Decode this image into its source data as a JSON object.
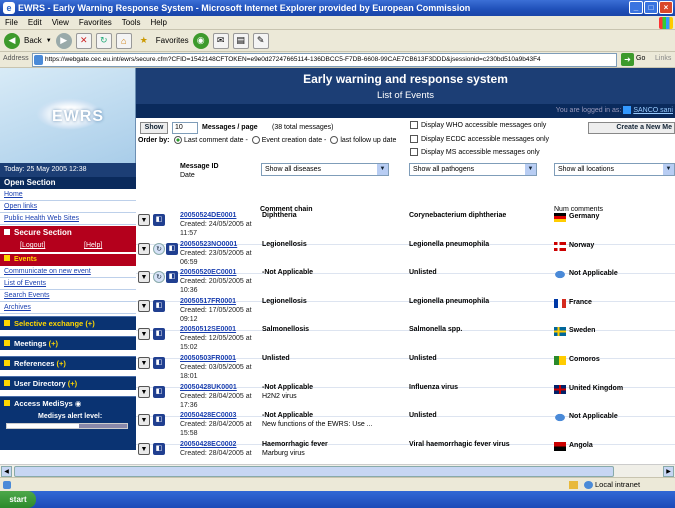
{
  "window": {
    "title": "EWRS - Early Warning Response System - Microsoft Internet Explorer provided by European Commission"
  },
  "menubar": {
    "items": [
      "File",
      "Edit",
      "View",
      "Favorites",
      "Tools",
      "Help"
    ]
  },
  "toolbar": {
    "back": "Back",
    "favorites": "Favorites"
  },
  "address": {
    "label": "Address",
    "url": "https://webgate.cec.eu.int/ewrs/secure.cfm?CFID=1542148CFTOKEN=e9e0d27247665114-136DBCC5-F7DB-6608-99CAE7CB613F3DDD&jsessionid=c230bd510a9b43F4",
    "go": "Go",
    "links": "Links"
  },
  "sidebar": {
    "logo": "EWRS",
    "date": "Today: 25 May 2005 12:38",
    "open_section": "Open Section",
    "open_links": [
      "Home",
      "Open links",
      "Public Health Web Sites"
    ],
    "secure_section": "Secure Section",
    "logout": "[Logout]",
    "help": "[Help]",
    "events": "Events",
    "event_links": [
      "Communicate on new event",
      "List of Events",
      "Search Events",
      "Archives"
    ],
    "sections": [
      {
        "label": "Selective exchange",
        "badge": "(+)"
      },
      {
        "label": "Meetings",
        "badge": "(+)"
      },
      {
        "label": "References",
        "badge": "(+)"
      },
      {
        "label": "User Directory",
        "badge": "(+)"
      },
      {
        "label": "Access MediSys",
        "badge": ""
      }
    ],
    "medisys": "Medisys alert level:"
  },
  "main": {
    "title": "Early warning and response system",
    "subtitle": "List of Events",
    "logged_in": "You are logged in as:",
    "logged_user": "SANCO sani",
    "show_button": "Show",
    "messages_per_page": "10",
    "messages_label": "Messages / page",
    "total": "(38 total messages)",
    "order_by": "Order by:",
    "order_options": [
      "Last comment date -",
      "Event creation date -",
      "last follow up date"
    ],
    "display_checks": [
      "Display WHO accessible messages only",
      "Display ECDC accessible messages only",
      "Display MS accessible messages only"
    ],
    "create_button": "Create a New Me",
    "col_message_id": "Message ID",
    "col_date": "Date",
    "col_comment": "Comment chain",
    "col_num": "Num comments",
    "filter_disease": "Show all diseases",
    "filter_pathogen": "Show all pathogens",
    "filter_location": "Show all locations",
    "rows": [
      {
        "id": "20050524DE0001",
        "created": "Created: 24/05/2005 at",
        "time": "11:57",
        "disease": "Diphtheria",
        "sub": "",
        "pathogen": "Corynebacterium diphtheriae",
        "country": "Germany",
        "flag": "de",
        "hist": false
      },
      {
        "id": "20050523NO0001",
        "created": "Created: 23/05/2005 at",
        "time": "06:59",
        "disease": "Legionellosis",
        "sub": "",
        "pathogen": "Legionella pneumophila",
        "country": "Norway",
        "flag": "no",
        "hist": true
      },
      {
        "id": "20050520EC0001",
        "created": "Created: 20/05/2005 at",
        "time": "10:36",
        "disease": "-Not Applicable",
        "sub": "",
        "pathogen": "Unlisted",
        "country": "Not Applicable",
        "flag": "na",
        "hist": true
      },
      {
        "id": "20050517FR0001",
        "created": "Created: 17/05/2005 at",
        "time": "09:12",
        "disease": "Legionellosis",
        "sub": "",
        "pathogen": "Legionella pneumophila",
        "country": "France",
        "flag": "fr",
        "hist": false
      },
      {
        "id": "20050512SE0001",
        "created": "Created: 12/05/2005 at",
        "time": "15:02",
        "disease": "Salmonellosis",
        "sub": "",
        "pathogen": "Salmonella spp.",
        "country": "Sweden",
        "flag": "se",
        "hist": false
      },
      {
        "id": "20050503FR0001",
        "created": "Created: 03/05/2005 at",
        "time": "18:01",
        "disease": "Unlisted",
        "sub": "",
        "pathogen": "Unlisted",
        "country": "Comoros",
        "flag": "km",
        "hist": false
      },
      {
        "id": "20050428UK0001",
        "created": "Created: 28/04/2005 at",
        "time": "17:36",
        "disease": "-Not Applicable",
        "sub": "H2N2 virus",
        "pathogen": "Influenza virus",
        "country": "United Kingdom",
        "flag": "uk",
        "hist": false
      },
      {
        "id": "20050428EC0003",
        "created": "Created: 28/04/2005 at",
        "time": "15:58",
        "disease": "-Not Applicable",
        "sub": "New functions of the EWRS: Use ...",
        "pathogen": "Unlisted",
        "country": "Not Applicable",
        "flag": "na",
        "hist": false
      },
      {
        "id": "20050428EC0002",
        "created": "Created: 28/04/2005 at",
        "time": "",
        "disease": "Haemorrhagic fever",
        "sub": "Marburg virus",
        "pathogen": "Viral haemorrhagic fever virus",
        "country": "Angola",
        "flag": "ao",
        "hist": false
      }
    ]
  },
  "status": {
    "zone": "Local intranet"
  },
  "taskbar": {
    "start": "start"
  },
  "colors": {
    "header_blue": "#1c3e75",
    "nav_dark": "#0a2a5c",
    "secure_red": "#b4001c",
    "link": "#1a3fb0"
  }
}
